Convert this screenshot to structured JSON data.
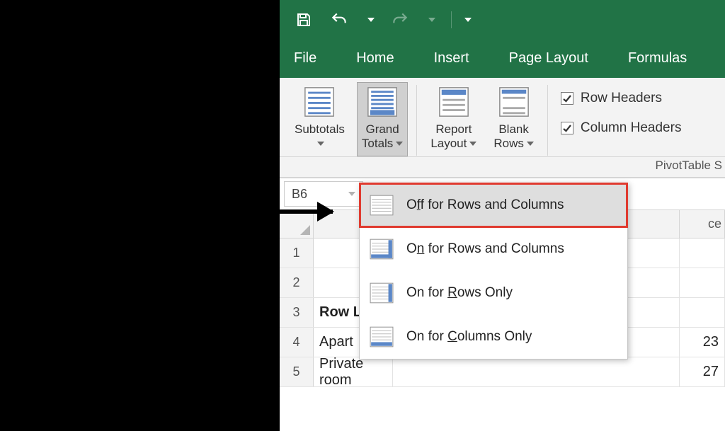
{
  "qat": {
    "save": "save-icon",
    "undo": "undo-icon",
    "redo": "redo-icon",
    "custom": "qat-dropdown-icon"
  },
  "tabs": {
    "file": "File",
    "home": "Home",
    "insert": "Insert",
    "pagelayout": "Page Layout",
    "formulas": "Formulas"
  },
  "ribbon": {
    "subtotals": "Subtotals",
    "grand_totals": "Grand\nTotals",
    "report_layout": "Report\nLayout",
    "blank_rows": "Blank\nRows",
    "row_headers": "Row Headers",
    "column_headers": "Column Headers",
    "pivot_style_opts": "PivotTable S"
  },
  "grand_totals_menu": {
    "off": "Off for Rows and Columns",
    "on_both": "On for Rows and Columns",
    "on_rows": "On for Rows Only",
    "on_cols": "On for Columns Only",
    "underline": {
      "off": "f",
      "on_both": "n",
      "on_rows": "R",
      "on_cols": "C"
    }
  },
  "namebox": {
    "ref": "B6"
  },
  "sheet": {
    "col_visible_right": "ce",
    "rows": [
      {
        "n": "1",
        "b": "",
        "right": ""
      },
      {
        "n": "2",
        "b": "",
        "right": ""
      },
      {
        "n": "3",
        "b": "Row L",
        "right": "",
        "bold": true
      },
      {
        "n": "4",
        "b": "Apart",
        "right": "23"
      },
      {
        "n": "5",
        "b": "Private room",
        "right": "27"
      }
    ]
  }
}
